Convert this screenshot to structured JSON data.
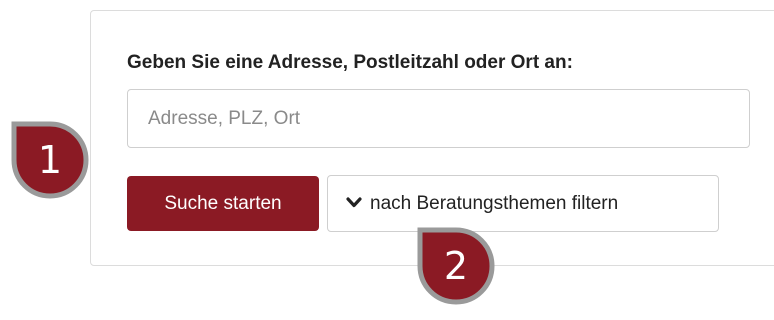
{
  "form": {
    "prompt": "Geben Sie eine Adresse, Postleitzahl oder Ort an:",
    "search_placeholder": "Adresse, PLZ, Ort",
    "search_value": "",
    "submit_label": "Suche starten",
    "filter_label": "nach Beratungsthemen filtern",
    "filter_icon": "chevron-down-icon"
  },
  "callouts": [
    {
      "number": "1"
    },
    {
      "number": "2"
    }
  ],
  "colors": {
    "accent": "#8b1a24",
    "callout_fill": "#8b1a24",
    "callout_border": "#9a9a9a"
  }
}
